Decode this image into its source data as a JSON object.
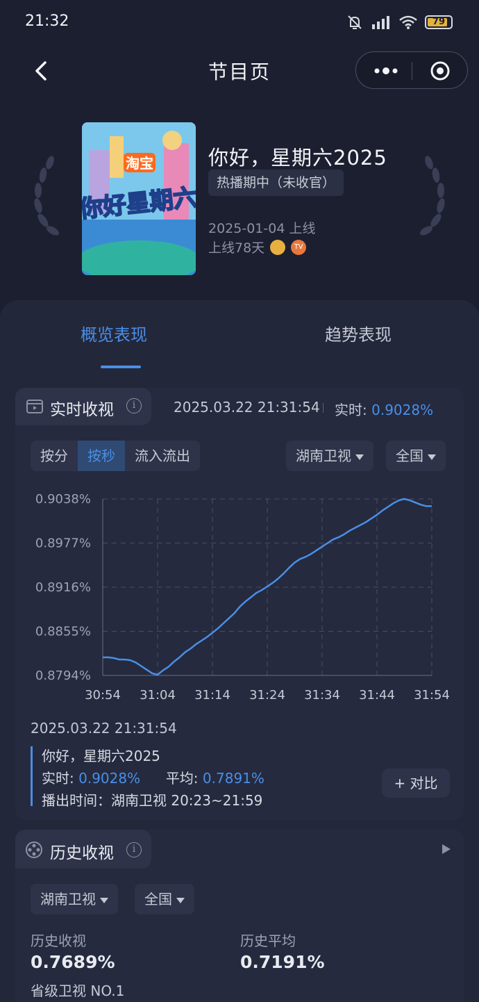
{
  "status_bar": {
    "time": "21:32",
    "battery": "79"
  },
  "nav": {
    "title": "节目页"
  },
  "show": {
    "title": "你好，星期六2025",
    "status_tag": "热播期中（未收官）",
    "release_date": "2025-01-04 上线",
    "days_online": "上线78天",
    "poster_brand": "淘宝",
    "poster_text": "你好星期六",
    "platforms": [
      "mango-icon",
      "tv-icon"
    ]
  },
  "tabs": {
    "overview": "概览表现",
    "trend": "趋势表现"
  },
  "realtime": {
    "title": "实时收视",
    "info_glyph": "i",
    "timestamp": "2025.03.22 21:31:54",
    "live_label": "实时: ",
    "live_value": "0.9028%",
    "segments": [
      "按分",
      "按秒",
      "流入流出"
    ],
    "active_segment": 1,
    "channel": "湖南卫视",
    "region": "全国"
  },
  "chart_data": {
    "type": "line",
    "y_tick_labels": [
      "0.9038%",
      "0.8977%",
      "0.8916%",
      "0.8855%",
      "0.8794%"
    ],
    "x_tick_labels": [
      "30:54",
      "31:04",
      "31:14",
      "31:24",
      "31:34",
      "31:44",
      "31:54"
    ],
    "ylim": [
      0.8794,
      0.9038
    ],
    "xlim_seconds": [
      0,
      60
    ],
    "grid": true,
    "series": [
      {
        "color": "#4a8fe6",
        "points": [
          [
            0,
            0.8819
          ],
          [
            1,
            0.8819
          ],
          [
            2,
            0.8818
          ],
          [
            3,
            0.8816
          ],
          [
            4,
            0.8816
          ],
          [
            5,
            0.8815
          ],
          [
            6,
            0.8812
          ],
          [
            7,
            0.8807
          ],
          [
            8,
            0.8802
          ],
          [
            9,
            0.8797
          ],
          [
            10,
            0.8795
          ],
          [
            11,
            0.8801
          ],
          [
            12,
            0.8806
          ],
          [
            13,
            0.8813
          ],
          [
            14,
            0.8819
          ],
          [
            15,
            0.8826
          ],
          [
            16,
            0.8831
          ],
          [
            17,
            0.8837
          ],
          [
            18,
            0.8842
          ],
          [
            19,
            0.8847
          ],
          [
            20,
            0.8853
          ],
          [
            21,
            0.8859
          ],
          [
            22,
            0.8866
          ],
          [
            23,
            0.8873
          ],
          [
            24,
            0.888
          ],
          [
            25,
            0.8889
          ],
          [
            26,
            0.8896
          ],
          [
            27,
            0.8902
          ],
          [
            28,
            0.8908
          ],
          [
            29,
            0.8912
          ],
          [
            30,
            0.8917
          ],
          [
            31,
            0.8922
          ],
          [
            32,
            0.8928
          ],
          [
            33,
            0.8935
          ],
          [
            34,
            0.8943
          ],
          [
            35,
            0.895
          ],
          [
            36,
            0.8955
          ],
          [
            37,
            0.8958
          ],
          [
            38,
            0.8962
          ],
          [
            39,
            0.8967
          ],
          [
            40,
            0.8972
          ],
          [
            41,
            0.8977
          ],
          [
            42,
            0.8982
          ],
          [
            43,
            0.8985
          ],
          [
            44,
            0.8989
          ],
          [
            45,
            0.8994
          ],
          [
            46,
            0.8998
          ],
          [
            47,
            0.9002
          ],
          [
            48,
            0.9006
          ],
          [
            49,
            0.9011
          ],
          [
            50,
            0.9016
          ],
          [
            51,
            0.9022
          ],
          [
            52,
            0.9027
          ],
          [
            53,
            0.9032
          ],
          [
            54,
            0.9036
          ],
          [
            55,
            0.9038
          ],
          [
            56,
            0.9036
          ],
          [
            57,
            0.9033
          ],
          [
            58,
            0.903
          ],
          [
            59,
            0.9028
          ],
          [
            60,
            0.9028
          ]
        ]
      }
    ]
  },
  "detail": {
    "timestamp": "2025.03.22 21:31:54",
    "show_name": "你好，星期六2025",
    "live_label": "实时: ",
    "live_value": "0.9028%",
    "avg_label": "平均: ",
    "avg_value": "0.7891%",
    "airtime": "播出时间：湖南卫视 20:23~21:59",
    "compare_button": "+ 对比"
  },
  "history": {
    "title": "历史收视",
    "info_glyph": "i",
    "channel": "湖南卫视",
    "region": "全国",
    "rating_label": "历史收视",
    "rating_value": "0.7689%",
    "average_label": "历史平均",
    "average_value": "0.7191%",
    "rank": "省级卫视 NO.1"
  }
}
